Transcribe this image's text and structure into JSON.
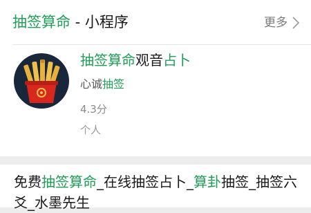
{
  "header": {
    "title_highlight": "抽签算命",
    "title_suffix": " - 小程序",
    "more_label": "更多"
  },
  "app": {
    "name_highlight_1": "抽签算命",
    "name_plain": "观音",
    "name_highlight_2": "占卜",
    "desc_plain": "心诚",
    "desc_highlight": "抽签",
    "rating": "4.3分",
    "type": "个人"
  },
  "article": {
    "segments": [
      {
        "text": "免费",
        "hl": false
      },
      {
        "text": "抽签算命",
        "hl": true
      },
      {
        "text": "_在线抽签占卜_",
        "hl": false
      },
      {
        "text": "算卦",
        "hl": true
      },
      {
        "text": "抽签_抽签六爻_水墨先生",
        "hl": false
      }
    ]
  },
  "colors": {
    "highlight": "#1e9e56",
    "icon_background": "#19273a",
    "icon_cup": "#d8281e",
    "icon_sticks": "#e8b23a"
  },
  "icons": {
    "app_icon": "fortune-sticks-cup-icon",
    "more": "chevron-right-icon"
  }
}
